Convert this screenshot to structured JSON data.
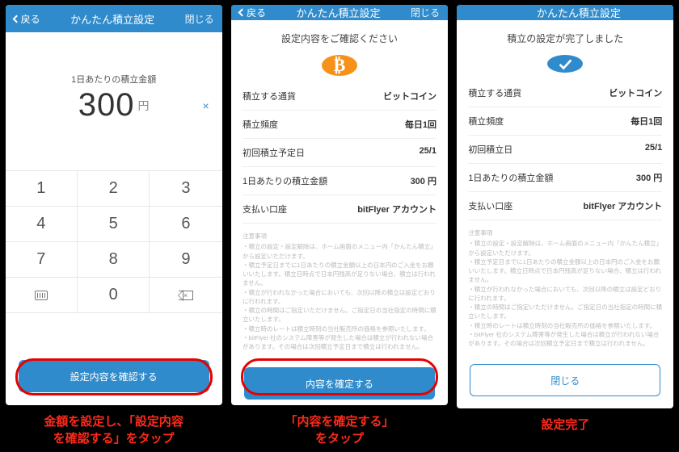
{
  "header": {
    "back": "戻る",
    "title": "かんたん積立設定",
    "close": "閉じる"
  },
  "screen1": {
    "amount_label": "1日あたりの積立金額",
    "amount_value": "300",
    "amount_unit": "円",
    "keys": [
      "1",
      "2",
      "3",
      "4",
      "5",
      "6",
      "7",
      "8",
      "9",
      "",
      "0",
      ""
    ],
    "cta": "設定内容を確認する",
    "caption": "金額を設定し、「設定内容\nを確認する」をタップ"
  },
  "screen2": {
    "msg": "設定内容をご確認ください",
    "rows": [
      {
        "k": "積立する通貨",
        "v": "ビットコイン"
      },
      {
        "k": "積立頻度",
        "v": "毎日1回"
      },
      {
        "k": "初回積立予定日",
        "v": "25/1"
      },
      {
        "k": "1日あたりの積立金額",
        "v": "300 円"
      },
      {
        "k": "支払い口座",
        "v": "bitFlyer アカウント"
      }
    ],
    "cta": "内容を確定する",
    "caption": "「内容を確定する」\nをタップ"
  },
  "screen3": {
    "msg": "積立の設定が完了しました",
    "rows": [
      {
        "k": "積立する通貨",
        "v": "ビットコイン"
      },
      {
        "k": "積立頻度",
        "v": "毎日1回"
      },
      {
        "k": "初回積立日",
        "v": "25/1"
      },
      {
        "k": "1日あたりの積立金額",
        "v": "300 円"
      },
      {
        "k": "支払い口座",
        "v": "bitFlyer アカウント"
      }
    ],
    "cta": "閉じる",
    "caption": "設定完了"
  },
  "notes": {
    "heading": "注意事項",
    "lines": [
      "・積立の設定・設定解除は、ホーム画面のメニュー内「かんたん積立」から設定いただけます。",
      "・積立予定日までに1日あたりの積立金額以上の日本円のご入金をお願いいたします。積立日時点で日本円残高が足りない場合、積立は行われません。",
      "・積立が行われなかった場合においても、次回以降の積立は設定どおりに行われます。",
      "・積立の時間はご指定いただけません。ご指定日の当社指定の時間に積立いたします。",
      "・積立時のレートは積立時刻の当社販売所の価格を参照いたします。",
      "・bitFlyer 社のシステム障害等が発生した場合は積立が行われない場合があります。その場合は次回積立予定日まで積立は行われません。"
    ]
  }
}
